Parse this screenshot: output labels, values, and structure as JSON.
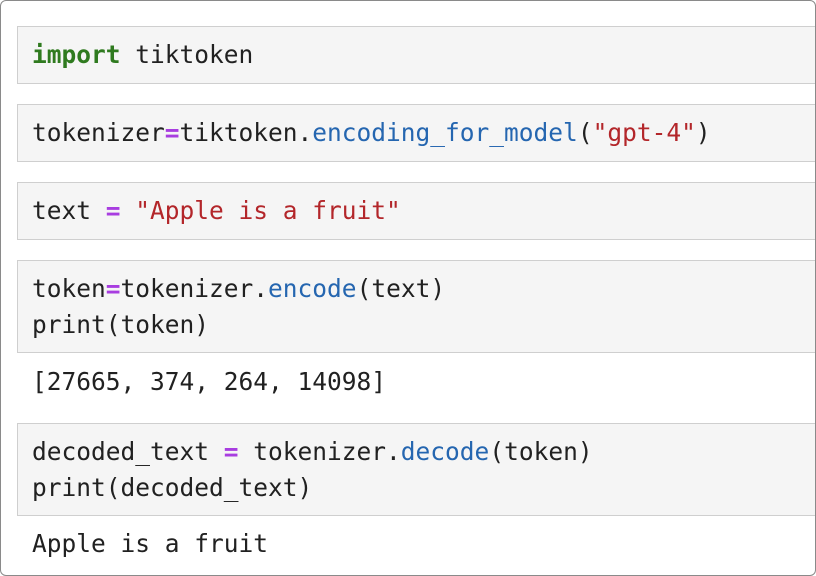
{
  "cells": [
    {
      "tokens": [
        {
          "text": "import",
          "type": "keyword"
        },
        {
          "text": " tiktoken",
          "type": "plain"
        }
      ]
    },
    {
      "tokens": [
        {
          "text": "tokenizer",
          "type": "plain"
        },
        {
          "text": "=",
          "type": "operator"
        },
        {
          "text": "tiktoken.",
          "type": "plain"
        },
        {
          "text": "encoding_for_model",
          "type": "function"
        },
        {
          "text": "(",
          "type": "plain"
        },
        {
          "text": "\"gpt-4\"",
          "type": "string"
        },
        {
          "text": ")",
          "type": "plain"
        }
      ]
    },
    {
      "tokens": [
        {
          "text": "text ",
          "type": "plain"
        },
        {
          "text": "=",
          "type": "operator"
        },
        {
          "text": " ",
          "type": "plain"
        },
        {
          "text": "\"Apple is a fruit\"",
          "type": "string"
        }
      ]
    },
    {
      "line1": [
        {
          "text": "token",
          "type": "plain"
        },
        {
          "text": "=",
          "type": "operator"
        },
        {
          "text": "tokenizer.",
          "type": "plain"
        },
        {
          "text": "encode",
          "type": "function"
        },
        {
          "text": "(text)",
          "type": "plain"
        }
      ],
      "line2": [
        {
          "text": "print(token)",
          "type": "plain"
        }
      ],
      "output": "[27665, 374, 264, 14098]"
    },
    {
      "line1": [
        {
          "text": "decoded_text ",
          "type": "plain"
        },
        {
          "text": "=",
          "type": "operator"
        },
        {
          "text": " tokenizer.",
          "type": "plain"
        },
        {
          "text": "decode",
          "type": "function"
        },
        {
          "text": "(token)",
          "type": "plain"
        }
      ],
      "line2": [
        {
          "text": "print(decoded_text)",
          "type": "plain"
        }
      ],
      "output": "Apple is a fruit"
    }
  ],
  "colors": {
    "keyword": "#2f7a1f",
    "operator": "#a83de0",
    "function": "#2566b0",
    "string": "#b3262a",
    "plain": "#212121",
    "cell_background": "#f5f5f5",
    "cell_border": "#cfcfcf"
  }
}
